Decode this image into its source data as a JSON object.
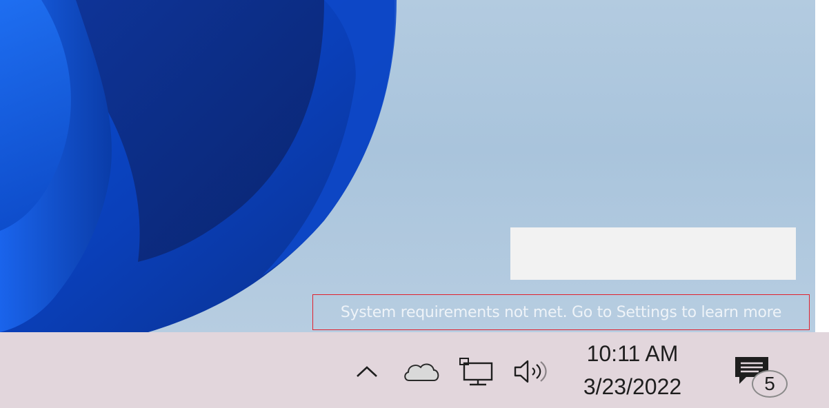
{
  "watermark": {
    "text": "System requirements not met. Go to Settings to learn more"
  },
  "taskbar": {
    "tray": {
      "icons": [
        "chevron-up-icon",
        "onedrive-cloud-icon",
        "network-icon",
        "volume-icon"
      ],
      "clock": {
        "time": "10:11 AM",
        "date": "3/23/2022"
      },
      "notifications": {
        "count": "5"
      }
    }
  },
  "colors": {
    "desktop_background": "#aac4dc",
    "wallpaper_blue": "#0a50d8",
    "taskbar_background": "#e2d6dc",
    "watermark_outline": "#e0202c"
  }
}
